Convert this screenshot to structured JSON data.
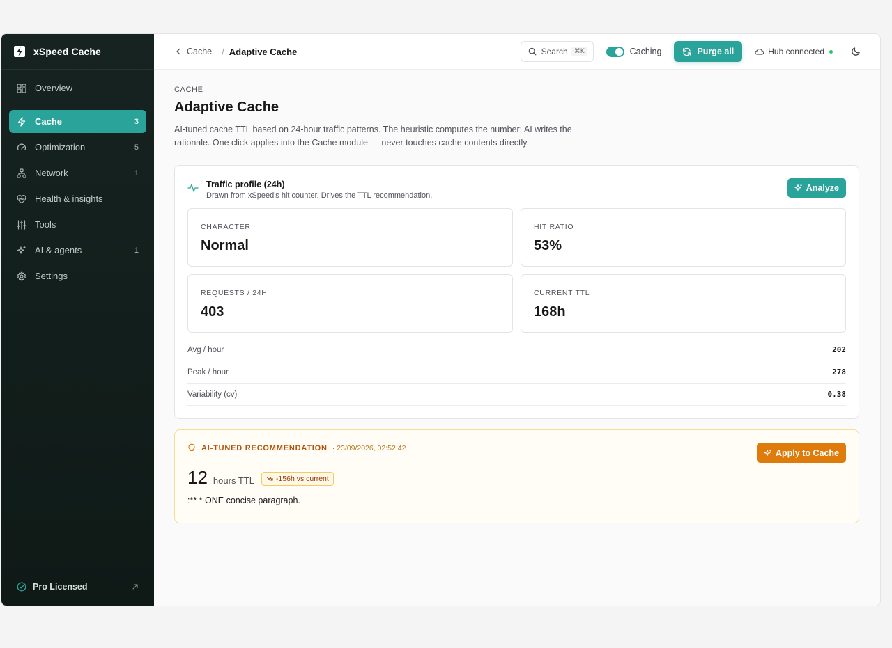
{
  "app": {
    "name": "xSpeed Cache"
  },
  "sidebar": {
    "items": [
      {
        "label": "Overview",
        "count": "",
        "icon": "grid-icon"
      },
      {
        "label": "Cache",
        "count": "3",
        "icon": "bolt-icon"
      },
      {
        "label": "Optimization",
        "count": "5",
        "icon": "gauge-icon"
      },
      {
        "label": "Network",
        "count": "1",
        "icon": "network-icon"
      },
      {
        "label": "Health & insights",
        "count": "",
        "icon": "heart-pulse-icon"
      },
      {
        "label": "Tools",
        "count": "",
        "icon": "sliders-icon"
      },
      {
        "label": "AI & agents",
        "count": "1",
        "icon": "sparkles-icon"
      },
      {
        "label": "Settings",
        "count": "",
        "icon": "gear-icon"
      }
    ],
    "active_item": "Cache",
    "footer_label": "Pro Licensed"
  },
  "topbar": {
    "back_label": "Cache",
    "separator": "/",
    "current": "Adaptive Cache",
    "search_label": "Search",
    "search_shortcut": "⌘K",
    "toggle_label": "Caching",
    "toggle_on": true,
    "purge_label": "Purge all",
    "hub_label": "Hub connected"
  },
  "page": {
    "eyebrow": "CACHE",
    "title": "Adaptive Cache",
    "description": "AI-tuned cache TTL based on 24-hour traffic patterns. The heuristic computes the number; AI writes the rationale. One click applies into the Cache module — never touches cache contents directly."
  },
  "traffic": {
    "title": "Traffic profile (24h)",
    "subtitle": "Drawn from xSpeed's hit counter. Drives the TTL recommendation.",
    "analyze_label": "Analyze",
    "stats": [
      {
        "label": "CHARACTER",
        "value": "Normal"
      },
      {
        "label": "HIT RATIO",
        "value": "53%"
      },
      {
        "label": "REQUESTS / 24H",
        "value": "403"
      },
      {
        "label": "CURRENT TTL",
        "value": "168h"
      }
    ],
    "metrics": [
      {
        "label": "Avg / hour",
        "value": "202"
      },
      {
        "label": "Peak / hour",
        "value": "278"
      },
      {
        "label": "Variability (cv)",
        "value": "0.38"
      }
    ]
  },
  "recommendation": {
    "label": "AI-TUNED RECOMMENDATION",
    "timestamp": "· 23/09/2026, 02:52:42",
    "apply_label": "Apply to Cache",
    "value": "12",
    "unit": "hours TTL",
    "delta": "-156h vs current",
    "body": ":** * ONE concise paragraph."
  },
  "colors": {
    "accent": "#2aa39a",
    "sidebar_bg": "#132420",
    "warning": "#df7b0a",
    "status_ok": "#22c55e"
  }
}
